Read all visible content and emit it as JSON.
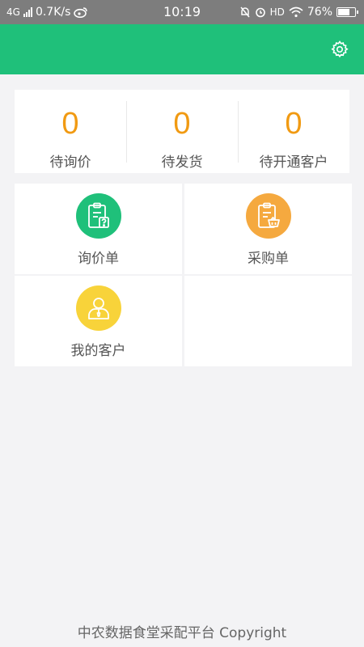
{
  "status_bar": {
    "network": "4G",
    "speed": "0.7K/s",
    "time": "10:19",
    "hd": "HD",
    "battery_percent": "76%",
    "battery_level": 0.76
  },
  "header": {
    "background": "#1fc07a",
    "settings_icon": "gear-icon"
  },
  "stats": [
    {
      "value": "0",
      "label": "待询价"
    },
    {
      "value": "0",
      "label": "待发货"
    },
    {
      "value": "0",
      "label": "待开通客户"
    }
  ],
  "menu": [
    {
      "label": "询价单",
      "icon": "clipboard-question-icon",
      "color": "#1fc07a"
    },
    {
      "label": "采购单",
      "icon": "clipboard-basket-icon",
      "color": "#f5a93f"
    },
    {
      "label": "我的客户",
      "icon": "user-icon",
      "color": "#f8d33a"
    }
  ],
  "footer": {
    "text": "中农数据食堂采配平台 Copyright"
  }
}
